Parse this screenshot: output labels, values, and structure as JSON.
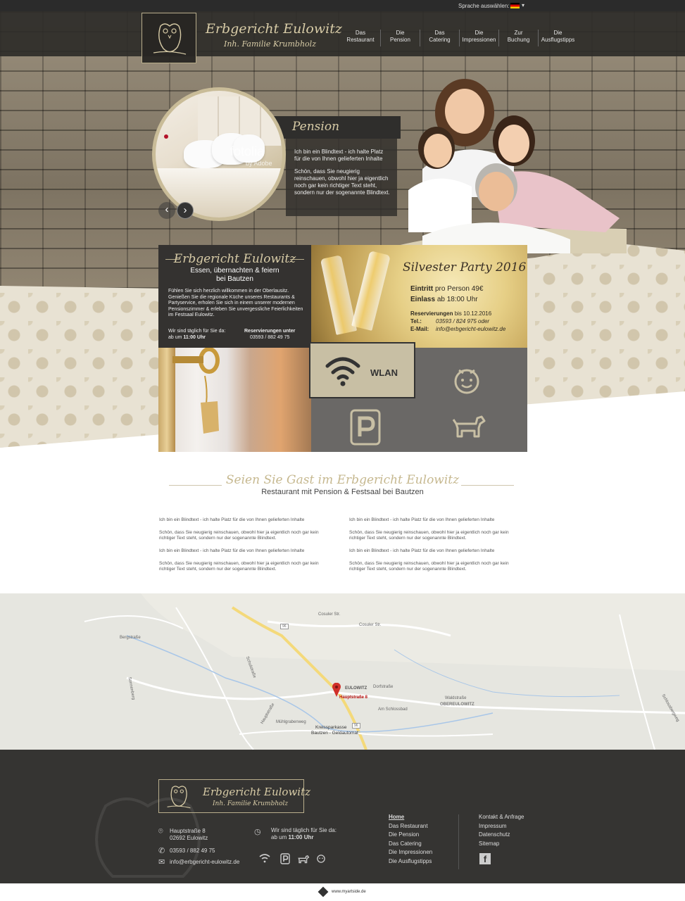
{
  "topbar": {
    "language_label": "Sprache auswählen:",
    "language_flag": "german-flag-icon"
  },
  "brand": {
    "name": "Erbgericht Eulowitz",
    "subtitle": "Inh. Familie Krumbholz"
  },
  "nav": [
    {
      "line1": "Das",
      "line2": "Restaurant"
    },
    {
      "line1": "Die",
      "line2": "Pension"
    },
    {
      "line1": "Das",
      "line2": "Catering"
    },
    {
      "line1": "Die",
      "line2": "Impressionen"
    },
    {
      "line1": "Zur",
      "line2": "Buchung"
    },
    {
      "line1": "Die",
      "line2": "Ausflugstipps"
    }
  ],
  "slider": {
    "title": "Pension",
    "watermark": "fotolia",
    "watermark_sub": "by Adobe",
    "text1": "Ich bin ein Blindtext - ich halte Platz für die von Ihnen gelieferten Inhalte",
    "text2": "Schön, dass Sie neugierig reinschauen, obwohl hier ja eigentlich noch gar kein richtiger Text steht, sondern nur der sogenannte Blindtext.",
    "prev": "‹",
    "next": "›"
  },
  "intro": {
    "title": "Erbgericht Eulowitz",
    "subtitle_line1": "Essen, übernachten & feiern",
    "subtitle_line2": "bei Bautzen",
    "text": "Fühlen Sie sich herzlich willkommen in der Oberlausitz. Genießen Sie die regionale Küche unseres Restaurants & Partyservice, erholen Sie sich in einem unserer modernen Pensionszimmer & erleben Sie unvergessliche Feierlichkeiten im Festsaal Eulowitz.",
    "hours_label": "Wir sind täglich für Sie da:",
    "hours_prefix": "ab um",
    "hours_time": "11:00 Uhr",
    "res_label": "Reservierungen unter",
    "res_phone": "03593 / 882 49 75"
  },
  "silvester": {
    "title": "Silvester Party 2016",
    "entry_bold": "Eintritt",
    "entry_rest": "pro Person 49€",
    "admit_bold": "Einlass",
    "admit_rest": "ab 18:00 Uhr",
    "res_bold": "Reservierungen",
    "res_rest": "bis 10.12.2016",
    "tel_label": "Tel.:",
    "tel_value": "03593 / 824 975 oder",
    "email_label": "E-Mail:",
    "email_value": "info@erbgericht-eulowitz.de"
  },
  "features": {
    "wlan": "WLAN",
    "icons": [
      "wifi-icon",
      "child-icon",
      "parking-icon",
      "dog-icon"
    ]
  },
  "welcome": {
    "title": "Seien Sie Gast im Erbgericht Eulowitz",
    "subtitle": "Restaurant mit Pension & Festsaal bei Bautzen",
    "p1": "Ich bin ein Blindtext - ich halte Platz für die von Ihnen gelieferten Inhalte",
    "p2": "Schön, dass Sie neugierig reinschauen, obwohl hier ja eigentlich noch gar kein richtiger Text steht, sondern nur der sogenannte Blindtext."
  },
  "map": {
    "marker_label": "Hauptstraße 8",
    "place1": "EULOWITZ",
    "place2": "OBEREULOWITZ",
    "poi": "Kreissparkasse",
    "poi2": "Bautzen - Geldautomat",
    "road1": "Cosuler Str.",
    "road2": "Cosuler Str.",
    "road3": "Dorfstraße",
    "road4": "Waldstraße",
    "road5": "Am Schlossbad",
    "road6": "Bergstraße",
    "road7": "Mühlgrabenweg",
    "road8": "Hauptstraße",
    "road9": "Schulstraße",
    "road10": "Schlossbergweg",
    "road11": "Sonnenberg",
    "shield1": "96",
    "shield2": "96"
  },
  "footer": {
    "brand_name": "Erbgericht Eulowitz",
    "brand_sub": "Inh. Familie Krumbholz",
    "street": "Hauptstraße 8",
    "city": "02692 Eulowitz",
    "phone": "03593 / 882 49 75",
    "email": "info@erbgericht-eulowitz.de",
    "hours_label": "Wir sind täglich für Sie da:",
    "hours_prefix": "ab um",
    "hours_time": "11:00 Uhr",
    "nav1": [
      "Home",
      "Das Restaurant",
      "Die Pension",
      "Das Catering",
      "Die Impressionen",
      "Die Ausflugstipps"
    ],
    "nav2": [
      "Kontakt & Anfrage",
      "Impressum",
      "Datenschutz",
      "Sitemap"
    ],
    "facebook": "f"
  },
  "credit": "www.myartside.de"
}
